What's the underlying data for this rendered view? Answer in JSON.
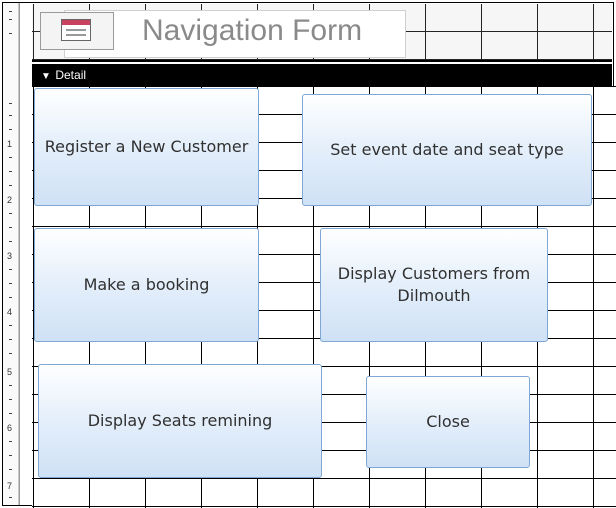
{
  "form": {
    "title": "Navigation Form",
    "section_label": "Detail"
  },
  "ruler": {
    "numbers": [
      "1",
      "2",
      "3",
      "4",
      "5",
      "6",
      "7"
    ]
  },
  "buttons": {
    "register": "Register a New Customer",
    "set_event": "Set event date and seat type",
    "booking": "Make a booking",
    "display_customers": "Display Customers from Dilmouth",
    "display_seats": "Display Seats remining",
    "close": "Close"
  },
  "colors": {
    "button_border": "#7ea7d6",
    "button_fill": "#cfe1f5",
    "icon_titlebar": "#c8415f"
  },
  "icons": {
    "form": "form-icon",
    "section": "chevron-down-icon"
  }
}
